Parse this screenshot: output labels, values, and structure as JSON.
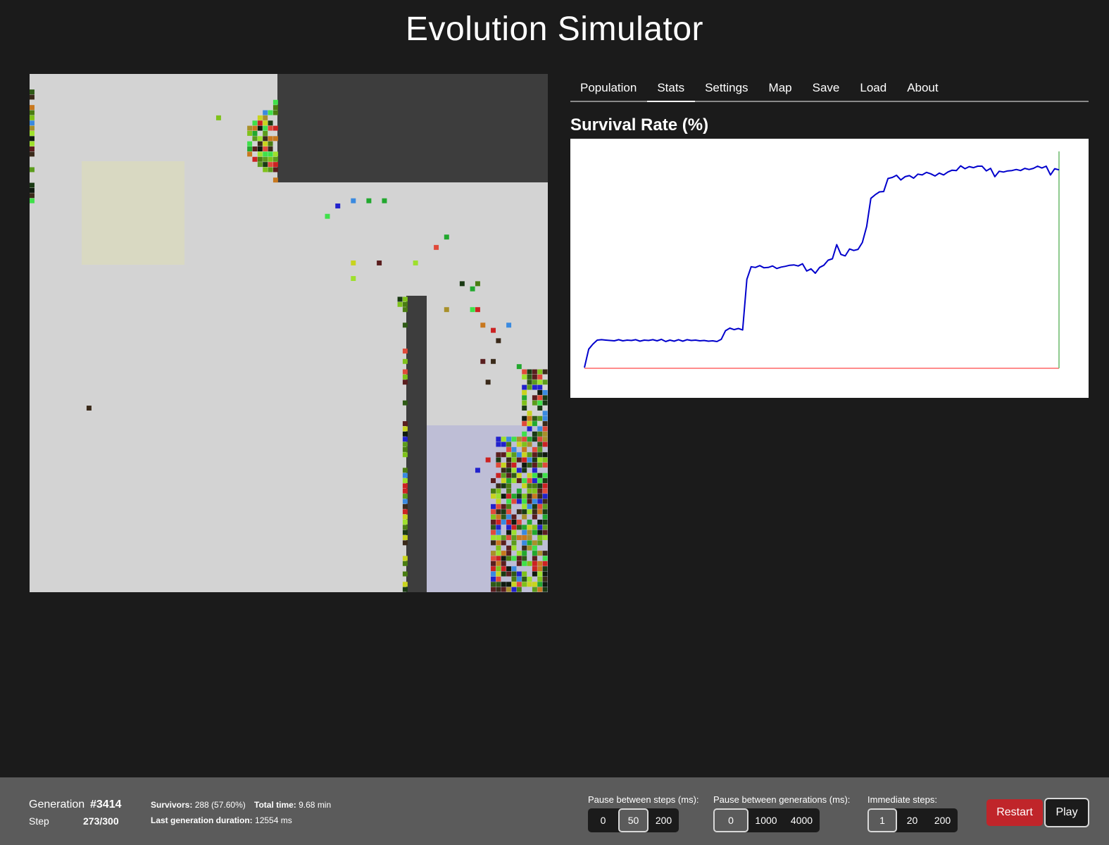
{
  "app": {
    "title": "Evolution Simulator"
  },
  "tabs": [
    {
      "label": "Population"
    },
    {
      "label": "Stats",
      "active": true
    },
    {
      "label": "Settings"
    },
    {
      "label": "Map"
    },
    {
      "label": "Save"
    },
    {
      "label": "Load"
    },
    {
      "label": "About"
    }
  ],
  "colors": {
    "world_background": "#d3d3d3",
    "wall": "#3d3d3d",
    "spawn_zone_yellow": "#d9d9c2",
    "goal_zone_lavender": "#bebed6",
    "line_series": "#0000cc",
    "baseline": "#ff6666",
    "step_marker": "#6ab86a",
    "restart_button": "#c0252a"
  },
  "world": {
    "creature_palette": [
      "#1a3a14",
      "#2f5a16",
      "#4a7d12",
      "#5c9c1c",
      "#7fc21a",
      "#9ee02c",
      "#22a82e",
      "#3fe14a",
      "#c8d41e",
      "#a8902a",
      "#c8781e",
      "#cc2222",
      "#e04a3a",
      "#5a1e1e",
      "#3a2a1a",
      "#2222cc",
      "#3a8ae0",
      "#0f1a0f"
    ],
    "description_free": true
  },
  "chart_data": {
    "type": "line",
    "title": "Survival Rate (%)",
    "xlabel": "",
    "ylabel": "",
    "grid": false,
    "legend": false,
    "x_range": [
      0,
      3414
    ],
    "ylim": [
      0,
      60
    ],
    "series": [
      {
        "values": [
          0.2,
          5.3,
          6.7,
          7.8,
          7.9,
          7.8,
          7.7,
          7.6,
          7.9,
          7.6,
          7.8,
          7.7,
          7.9,
          7.5,
          7.8,
          7.7,
          7.9,
          7.6,
          8.0,
          7.4,
          7.8,
          7.5,
          7.9,
          7.5,
          7.9,
          7.7,
          7.8,
          7.6,
          7.7,
          7.5,
          7.6,
          7.4,
          8.0,
          10.4,
          11.1,
          10.7,
          11.0,
          10.6,
          24.6,
          28.1,
          27.9,
          28.4,
          27.8,
          27.9,
          28.3,
          27.6,
          28.0,
          28.2,
          28.5,
          28.6,
          28.3,
          28.9,
          26.9,
          27.5,
          26.3,
          27.9,
          28.5,
          29.9,
          30.3,
          34.2,
          31.5,
          31.1,
          33.0,
          32.6,
          32.9,
          34.8,
          39.2,
          47.0,
          48.0,
          48.8,
          48.9,
          52.5,
          52.8,
          53.4,
          52.1,
          53.0,
          53.3,
          52.6,
          53.7,
          53.5,
          54.2,
          53.8,
          53.2,
          54.0,
          53.5,
          54.3,
          54.8,
          54.7,
          56.0,
          55.2,
          55.8,
          55.5,
          55.9,
          55.9,
          54.6,
          55.3,
          53.0,
          54.5,
          54.3,
          54.6,
          54.7,
          55.0,
          54.7,
          55.3,
          55.0,
          55.3,
          55.9,
          55.4,
          55.9,
          53.5,
          55.2,
          54.9
        ]
      }
    ],
    "baseline_value": 0,
    "current_marker": "end"
  },
  "status": {
    "generation_label": "Generation",
    "generation_value": "#3414",
    "step_label": "Step",
    "step_value": "273/300",
    "survivors_label": "Survivors:",
    "survivors_value": "288 (57.60%)",
    "total_time_label": "Total time:",
    "total_time_value": "9.68 min",
    "last_gen_label": "Last generation duration:",
    "last_gen_value": "12554 ms"
  },
  "controls": {
    "pause_steps": {
      "label": "Pause between steps (ms):",
      "options": [
        "0",
        "50",
        "200"
      ],
      "selected": "50"
    },
    "pause_generations": {
      "label": "Pause between generations (ms):",
      "options": [
        "0",
        "1000",
        "4000"
      ],
      "selected": "0"
    },
    "immediate_steps": {
      "label": "Immediate steps:",
      "options": [
        "1",
        "20",
        "200"
      ],
      "selected": "1"
    },
    "restart_label": "Restart",
    "play_label": "Play"
  }
}
